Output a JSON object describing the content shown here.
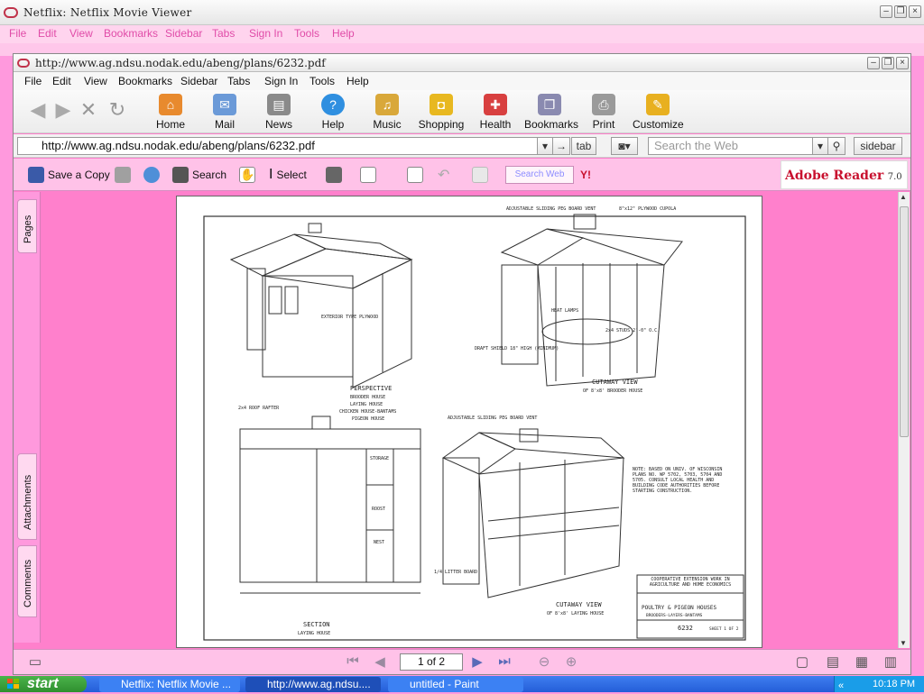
{
  "outer": {
    "title": "Netflix: Netflix Movie Viewer",
    "menu": [
      "File",
      "Edit",
      "View",
      "Bookmarks",
      "Sidebar",
      "Tabs",
      "Sign In",
      "Tools",
      "Help"
    ]
  },
  "inner": {
    "title": "http://www.ag.ndsu.nodak.edu/abeng/plans/6232.pdf",
    "menu": [
      "File",
      "Edit",
      "View",
      "Bookmarks",
      "Sidebar",
      "Tabs",
      "Sign In",
      "Tools",
      "Help"
    ],
    "toolbar": [
      "Home",
      "Mail",
      "News",
      "Help",
      "Music",
      "Shopping",
      "Health",
      "Bookmarks",
      "Print",
      "Customize"
    ],
    "address": "http://www.ag.ndsu.nodak.edu/abeng/plans/6232.pdf",
    "tab_button": "tab",
    "search_placeholder": "Search the Web",
    "sidebar_button": "sidebar"
  },
  "adobe": {
    "save_copy": "Save a Copy",
    "search": "Search",
    "select": "Select",
    "web_search": "Search Web",
    "logo": "Adobe Reader",
    "version": "7.0"
  },
  "side_tabs": [
    "Pages",
    "Attachments",
    "Comments"
  ],
  "document": {
    "labels": {
      "perspective": "PERSPECTIVE",
      "perspective_sub": [
        "BROODER HOUSE",
        "LAYING HOUSE",
        "CHICKEN HOUSE-BANTAMS",
        "PIGEON HOUSE"
      ],
      "exterior": "EXTERIOR TYPE PLYWOOD",
      "cutaway1": "CUTAWAY VIEW",
      "cutaway1_sub": "OF 8'x8' BROODER HOUSE",
      "section": "SECTION",
      "section_sub": "LAYING HOUSE",
      "cutaway2": "CUTAWAY VIEW",
      "cutaway2_sub": "OF 8'x8' LAYING HOUSE",
      "note": "NOTE: BASED ON UNIV. OF WISCONSIN PLANS NO. WP 5702, 5703, 5704 AND 5705. CONSULT LOCAL HEALTH AND BUILDING CODE AUTHORITIES BEFORE STARTING CONSTRUCTION.",
      "coop": "COOPERATIVE EXTENSION WORK IN AGRICULTURE AND HOME ECONOMICS",
      "titleblock": "POULTRY & PIGEON HOUSES",
      "titleblock_sub": "BROODERS-LAYERS-BANTAMS",
      "plan_no": "6232",
      "sheet": "SHEET 1 OF 2",
      "draft_shield": "DRAFT SHIELD 18\" HIGH (MINIMUM)",
      "heat_lamps": "HEAT LAMPS",
      "studs": "2x4 STUDS 2'-0\" O.C.",
      "peg_vent": "ADJUSTABLE SLIDING PEG BOARD VENT",
      "cupola": "8\"x12\" PLYWOOD CUPOLA",
      "storage": "STORAGE",
      "roost": "ROOST",
      "nest": "NEST",
      "litter": "1/4 LITTER BOARD"
    }
  },
  "navigation": {
    "page_indicator": "1 of 2"
  },
  "taskbar": {
    "start": "start",
    "tasks": [
      "Netflix: Netflix Movie ...",
      "http://www.ag.ndsu....",
      "untitled - Paint"
    ],
    "clock": "10:18 PM"
  },
  "colors": {
    "page_background": "#ff80cc",
    "menu_pink_text": "#e04ca8",
    "taskbar_blue": "#245ed8",
    "start_green": "#3fa33f"
  }
}
